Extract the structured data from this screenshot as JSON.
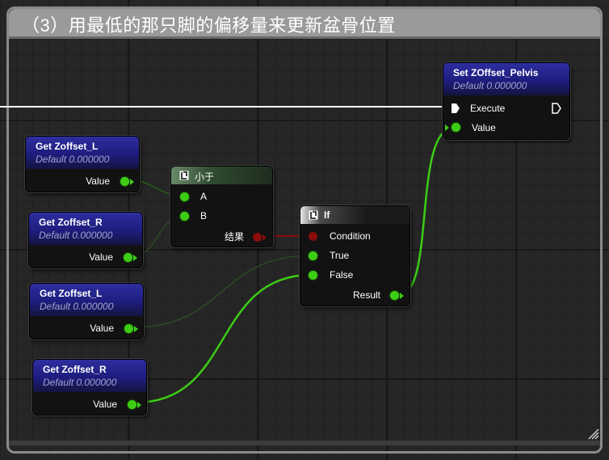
{
  "comment": {
    "title": "（3）用最低的那只脚的偏移量来更新盆骨位置"
  },
  "colors": {
    "float_pin": "#3ccd14",
    "bool_pin": "#8a0c0c",
    "var_header": "#1d1d7e",
    "less_header": "#2f4a2f",
    "exec": "#ffffff"
  },
  "nodes": {
    "set_pelvis": {
      "title": "Set ZOffset_Pelvis",
      "subtitle": "Default 0.000000",
      "exec_in": "Execute",
      "value_in": "Value"
    },
    "get_l1": {
      "title": "Get Zoffset_L",
      "subtitle": "Default 0.000000",
      "value_out": "Value"
    },
    "get_r1": {
      "title": "Get Zoffset_R",
      "subtitle": "Default 0.000000",
      "value_out": "Value"
    },
    "get_l2": {
      "title": "Get Zoffset_L",
      "subtitle": "Default 0.000000",
      "value_out": "Value"
    },
    "get_r2": {
      "title": "Get Zoffset_R",
      "subtitle": "Default 0.000000",
      "value_out": "Value"
    },
    "less": {
      "title": "小于",
      "a": "A",
      "b": "B",
      "out": "结果",
      "icon": "function-icon"
    },
    "if_node": {
      "title": "If",
      "condition": "Condition",
      "true_in": "True",
      "false_in": "False",
      "result": "Result",
      "icon": "function-icon"
    }
  }
}
